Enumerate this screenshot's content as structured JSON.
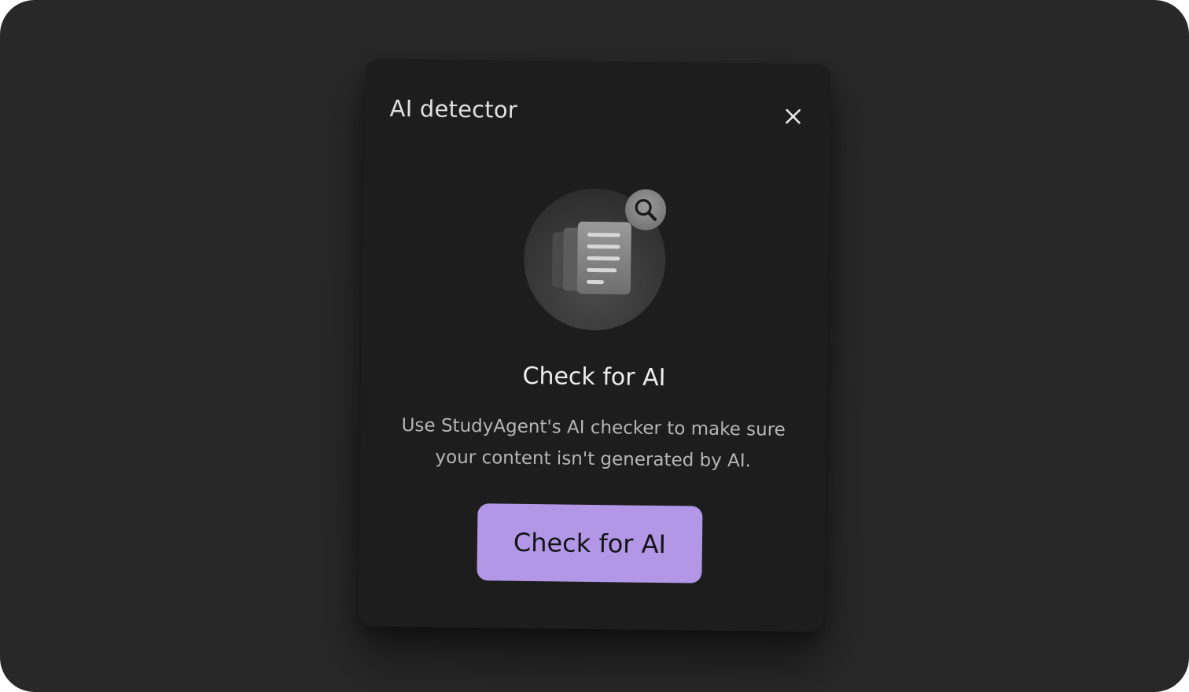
{
  "modal": {
    "title": "AI detector",
    "close_icon": "close-icon",
    "illustration_icons": [
      "documents-icon",
      "search-icon"
    ],
    "heading": "Check for AI",
    "description": "Use StudyAgent's AI checker to make sure your content isn't generated by AI.",
    "button_label": "Check for AI"
  },
  "colors": {
    "background": "#282828",
    "modal_background": "#1d1d1d",
    "accent": "#b197e6"
  }
}
